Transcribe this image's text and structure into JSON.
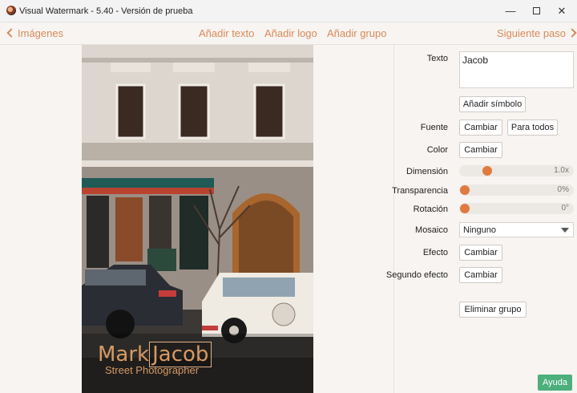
{
  "window": {
    "title": "Visual Watermark - 5.40 - Versión de prueba",
    "minimize": "—",
    "close": "✕"
  },
  "toolbar": {
    "back_label": "Imágenes",
    "add_text": "Añadir texto",
    "add_logo": "Añadir logo",
    "add_group": "Añadir grupo",
    "next_label": "Siguiente paso"
  },
  "watermark": {
    "word1": "Mark",
    "word2": "Jacob",
    "subtitle": "Street Photographer"
  },
  "panel": {
    "texto_label": "Texto",
    "texto_value": "Jacob",
    "add_symbol": "Añadir símbolo",
    "fuente_label": "Fuente",
    "fuente_change": "Cambiar",
    "para_todos": "Para todos",
    "color_label": "Color",
    "color_change": "Cambiar",
    "dimension_label": "Dimensión",
    "dimension_value": "1.0x",
    "dimension_level": 0.22,
    "transparencia_label": "Transparencia",
    "transparencia_value": "0%",
    "transparencia_level": 0,
    "rotacion_label": "Rotación",
    "rotacion_value": "0°",
    "rotacion_level": 0,
    "mosaico_label": "Mosaico",
    "mosaico_value": "Ninguno",
    "efecto_label": "Efecto",
    "efecto_change": "Cambiar",
    "segundo_label": "Segundo efecto",
    "segundo_change": "Cambiar",
    "delete_group": "Eliminar grupo",
    "help": "Ayuda"
  },
  "colors": {
    "accent": "#d88a5a",
    "slider_knob": "#e07a3f",
    "help_button": "#4caf7c",
    "watermark_text": "#d79a62"
  }
}
